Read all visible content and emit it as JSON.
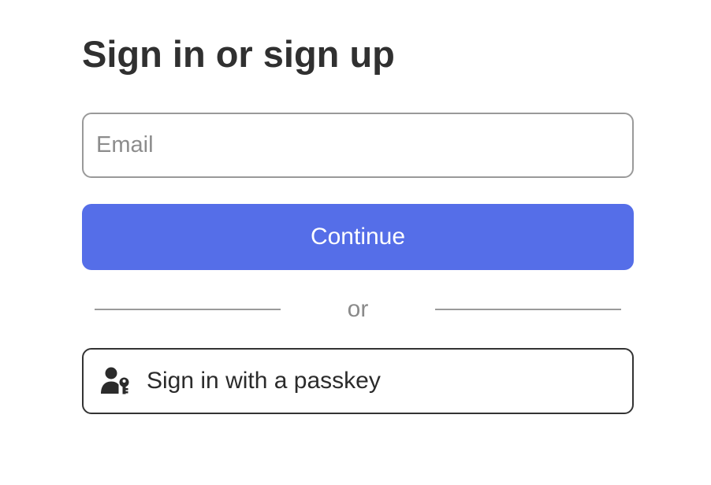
{
  "page": {
    "title": "Sign in or sign up"
  },
  "form": {
    "email_placeholder": "Email",
    "email_value": "",
    "continue_label": "Continue",
    "divider_text": "or",
    "passkey_label": "Sign in with a passkey",
    "passkey_icon": "user-key-icon"
  },
  "colors": {
    "primary": "#556ee8",
    "text": "#303030",
    "muted": "#8a8a8a",
    "border": "#9a9a9a"
  }
}
